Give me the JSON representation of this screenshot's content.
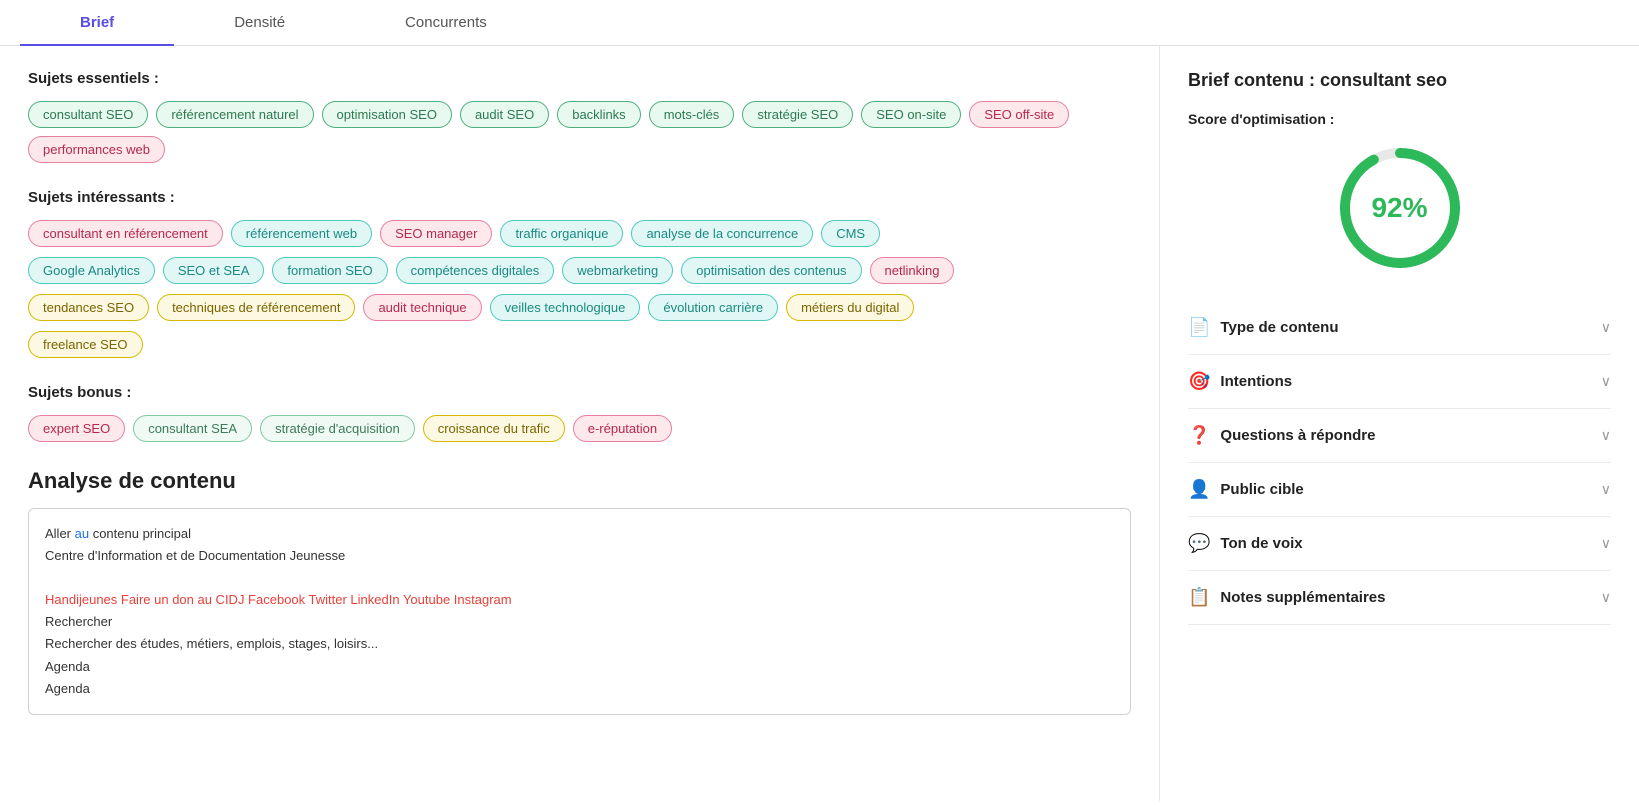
{
  "tabs": [
    {
      "label": "Brief",
      "active": true
    },
    {
      "label": "Densité",
      "active": false
    },
    {
      "label": "Concurrents",
      "active": false
    }
  ],
  "sujets_essentiels": {
    "title": "Sujets essentiels :",
    "tags": [
      {
        "label": "consultant SEO",
        "style": "green"
      },
      {
        "label": "référencement naturel",
        "style": "green"
      },
      {
        "label": "optimisation SEO",
        "style": "green"
      },
      {
        "label": "audit SEO",
        "style": "green"
      },
      {
        "label": "backlinks",
        "style": "green"
      },
      {
        "label": "mots-clés",
        "style": "green"
      },
      {
        "label": "stratégie SEO",
        "style": "green"
      },
      {
        "label": "SEO on-site",
        "style": "green"
      },
      {
        "label": "SEO off-site",
        "style": "pink"
      },
      {
        "label": "performances web",
        "style": "pink"
      }
    ]
  },
  "sujets_interessants": {
    "title": "Sujets intéressants :",
    "rows": [
      [
        {
          "label": "consultant en référencement",
          "style": "pink"
        },
        {
          "label": "référencement web",
          "style": "teal"
        },
        {
          "label": "SEO manager",
          "style": "pink"
        },
        {
          "label": "traffic organique",
          "style": "teal"
        },
        {
          "label": "analyse de la concurrence",
          "style": "teal"
        },
        {
          "label": "CMS",
          "style": "teal"
        }
      ],
      [
        {
          "label": "Google Analytics",
          "style": "teal"
        },
        {
          "label": "SEO et SEA",
          "style": "teal"
        },
        {
          "label": "formation SEO",
          "style": "teal"
        },
        {
          "label": "compétences digitales",
          "style": "teal"
        },
        {
          "label": "webmarketing",
          "style": "teal"
        },
        {
          "label": "optimisation des contenus",
          "style": "teal"
        },
        {
          "label": "netlinking",
          "style": "pink"
        }
      ],
      [
        {
          "label": "tendances SEO",
          "style": "yellow"
        },
        {
          "label": "techniques de référencement",
          "style": "yellow"
        },
        {
          "label": "audit technique",
          "style": "pink"
        },
        {
          "label": "veilles technologique",
          "style": "teal"
        },
        {
          "label": "évolution carrière",
          "style": "teal"
        },
        {
          "label": "métiers du digital",
          "style": "yellow"
        }
      ],
      [
        {
          "label": "freelance SEO",
          "style": "yellow"
        }
      ]
    ]
  },
  "sujets_bonus": {
    "title": "Sujets bonus :",
    "tags": [
      {
        "label": "expert SEO",
        "style": "pink"
      },
      {
        "label": "consultant SEA",
        "style": "light-green"
      },
      {
        "label": "stratégie d'acquisition",
        "style": "light-green"
      },
      {
        "label": "croissance du trafic",
        "style": "yellow"
      },
      {
        "label": "e-réputation",
        "style": "pink"
      }
    ]
  },
  "analyse": {
    "title": "Analyse de contenu",
    "content_lines": [
      {
        "text": "Aller au contenu principal",
        "type": "link-line",
        "link_word": "au"
      },
      {
        "text": "Centre d'Information et de Documentation Jeunesse",
        "type": "normal"
      },
      {
        "text": "",
        "type": "blank"
      },
      {
        "text": "Handijeunes Faire un don au CIDJ Facebook Twitter LinkedIn Youtube Instagram",
        "type": "red"
      },
      {
        "text": "Rechercher",
        "type": "normal"
      },
      {
        "text": "Rechercher des études, métiers, emplois, stages, loisirs...",
        "type": "normal"
      },
      {
        "text": "Agenda",
        "type": "normal"
      },
      {
        "text": "Agenda",
        "type": "normal"
      }
    ]
  },
  "right_panel": {
    "header": "Brief contenu : consultant seo",
    "score_label": "Score d'optimisation :",
    "score_value": "92%",
    "score_number": 92,
    "accordion_items": [
      {
        "icon": "📄",
        "title": "Type de contenu"
      },
      {
        "icon": "🎯",
        "title": "Intentions"
      },
      {
        "icon": "❓",
        "title": "Questions à répondre"
      },
      {
        "icon": "👤",
        "title": "Public cible"
      },
      {
        "icon": "💬",
        "title": "Ton de voix"
      },
      {
        "icon": "📋",
        "title": "Notes supplémentaires"
      }
    ]
  }
}
